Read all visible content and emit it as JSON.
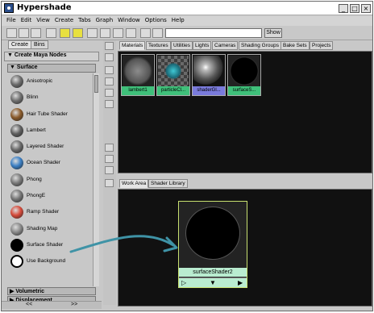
{
  "window": {
    "title": "Hypershade"
  },
  "menu": [
    "File",
    "Edit",
    "View",
    "Create",
    "Tabs",
    "Graph",
    "Window",
    "Options",
    "Help"
  ],
  "toolbar": {
    "show_label": "Show",
    "search_value": ""
  },
  "left_panel": {
    "tabs": [
      "Create",
      "Bins"
    ],
    "header": "Create Maya Nodes",
    "surface_section": "Surface",
    "shaders": [
      {
        "label": "Anisotropic",
        "color": "#6c6c6c"
      },
      {
        "label": "Blinn",
        "color": "#707070"
      },
      {
        "label": "Hair Tube Shader",
        "color": "#8a5a2a"
      },
      {
        "label": "Lambert",
        "color": "#5f5f5f"
      },
      {
        "label": "Layered Shader",
        "color": "#6a6a6a"
      },
      {
        "label": "Ocean Shader",
        "color": "#3b7fc4"
      },
      {
        "label": "Phong",
        "color": "#7a7a7a"
      },
      {
        "label": "PhongE",
        "color": "#767676"
      },
      {
        "label": "Ramp Shader",
        "color": "#d64a3a"
      },
      {
        "label": "Shading Map",
        "color": "#8a8a8a"
      },
      {
        "label": "Surface Shader",
        "color": "#000000"
      },
      {
        "label": "Use Background",
        "color": "#ffffff"
      }
    ],
    "sections": [
      "Volumetric",
      "Displacement"
    ],
    "bottom_nav": [
      "<<",
      ">>"
    ]
  },
  "top_tabs": [
    "Materials",
    "Textures",
    "Utilities",
    "Lights",
    "Cameras",
    "Shading Groups",
    "Bake Sets",
    "Projects"
  ],
  "materials": [
    {
      "label": "lambert1",
      "label_color": "#3fc07a",
      "icon": "grey-sphere"
    },
    {
      "label": "particleCl...",
      "label_color": "#3fc07a",
      "icon": "checker-sphere"
    },
    {
      "label": "shaderGl...",
      "label_color": "#7a7bdc",
      "icon": "glossy-sphere"
    },
    {
      "label": "surfaceS...",
      "label_color": "#3fc07a",
      "icon": "black-sphere"
    }
  ],
  "bottom_tabs": [
    "Work Area",
    "Shader Library"
  ],
  "work_node": {
    "label": "surfaceShader2"
  }
}
